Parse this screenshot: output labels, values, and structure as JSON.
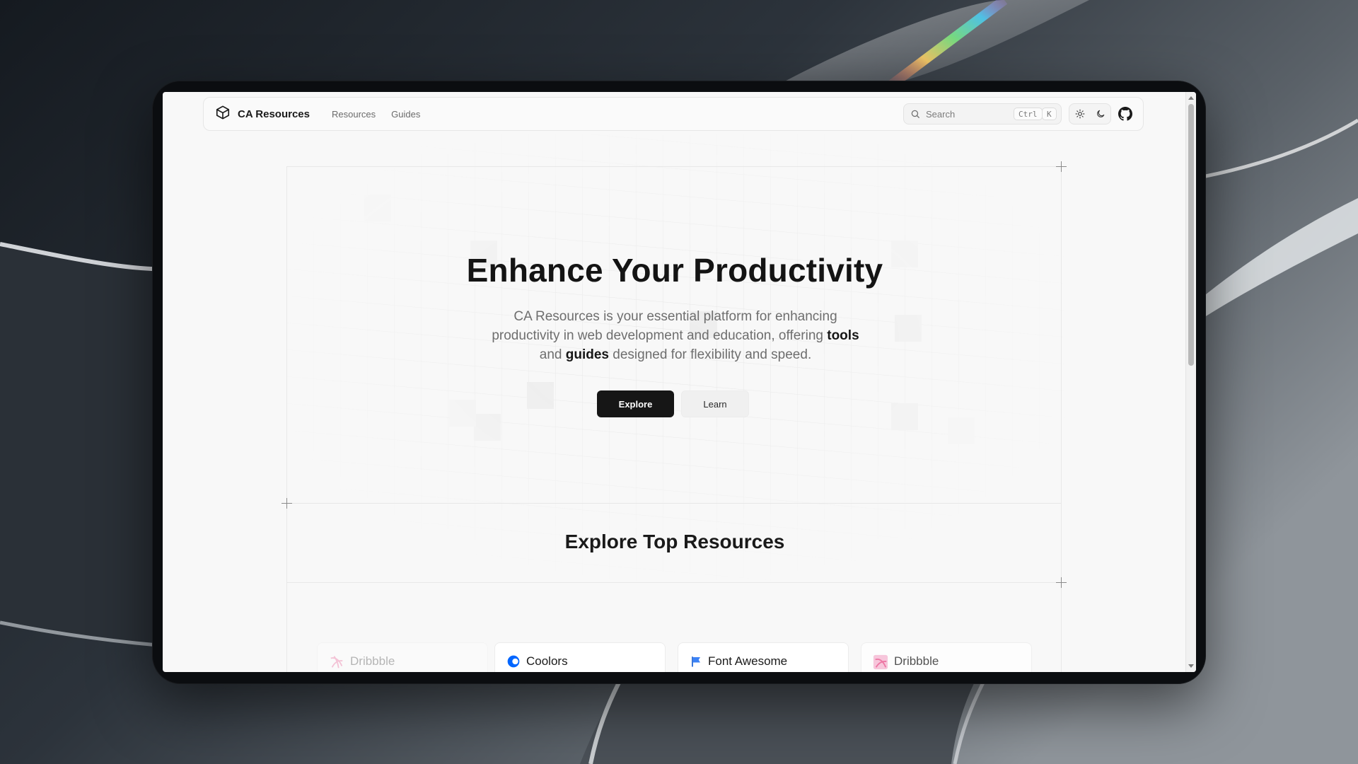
{
  "brand": {
    "name": "CA Resources",
    "logo_icon": "cube-icon"
  },
  "nav": {
    "links": [
      "Resources",
      "Guides"
    ]
  },
  "search": {
    "placeholder": "Search",
    "shortcut_modifier": "Ctrl",
    "shortcut_key": "K"
  },
  "theme": {
    "light_icon": "sun-icon",
    "dark_icon": "moon-icon"
  },
  "github": {
    "icon": "github-icon"
  },
  "hero": {
    "title": "Enhance Your Productivity",
    "desc_part1": "CA Resources is your essential platform for enhancing productivity in web development and education, offering",
    "desc_bold1": "tools",
    "desc_and": "and",
    "desc_bold2": "guides",
    "desc_part2": "designed for flexibility and speed.",
    "primary_button": "Explore",
    "secondary_button": "Learn"
  },
  "resources": {
    "title": "Explore Top Resources",
    "cards": [
      {
        "label": "Dribbble",
        "icon": "dribbble-icon"
      },
      {
        "label": "Coolors",
        "icon": "coolors-icon"
      },
      {
        "label": "Font Awesome",
        "icon": "font-awesome-flag-icon"
      },
      {
        "label": "Dribbble",
        "icon": "dribbble-icon"
      }
    ]
  },
  "colors": {
    "primary": "#161616",
    "accent_blue": "#3b82f6",
    "dribbble_pink": "#ea4c89"
  }
}
